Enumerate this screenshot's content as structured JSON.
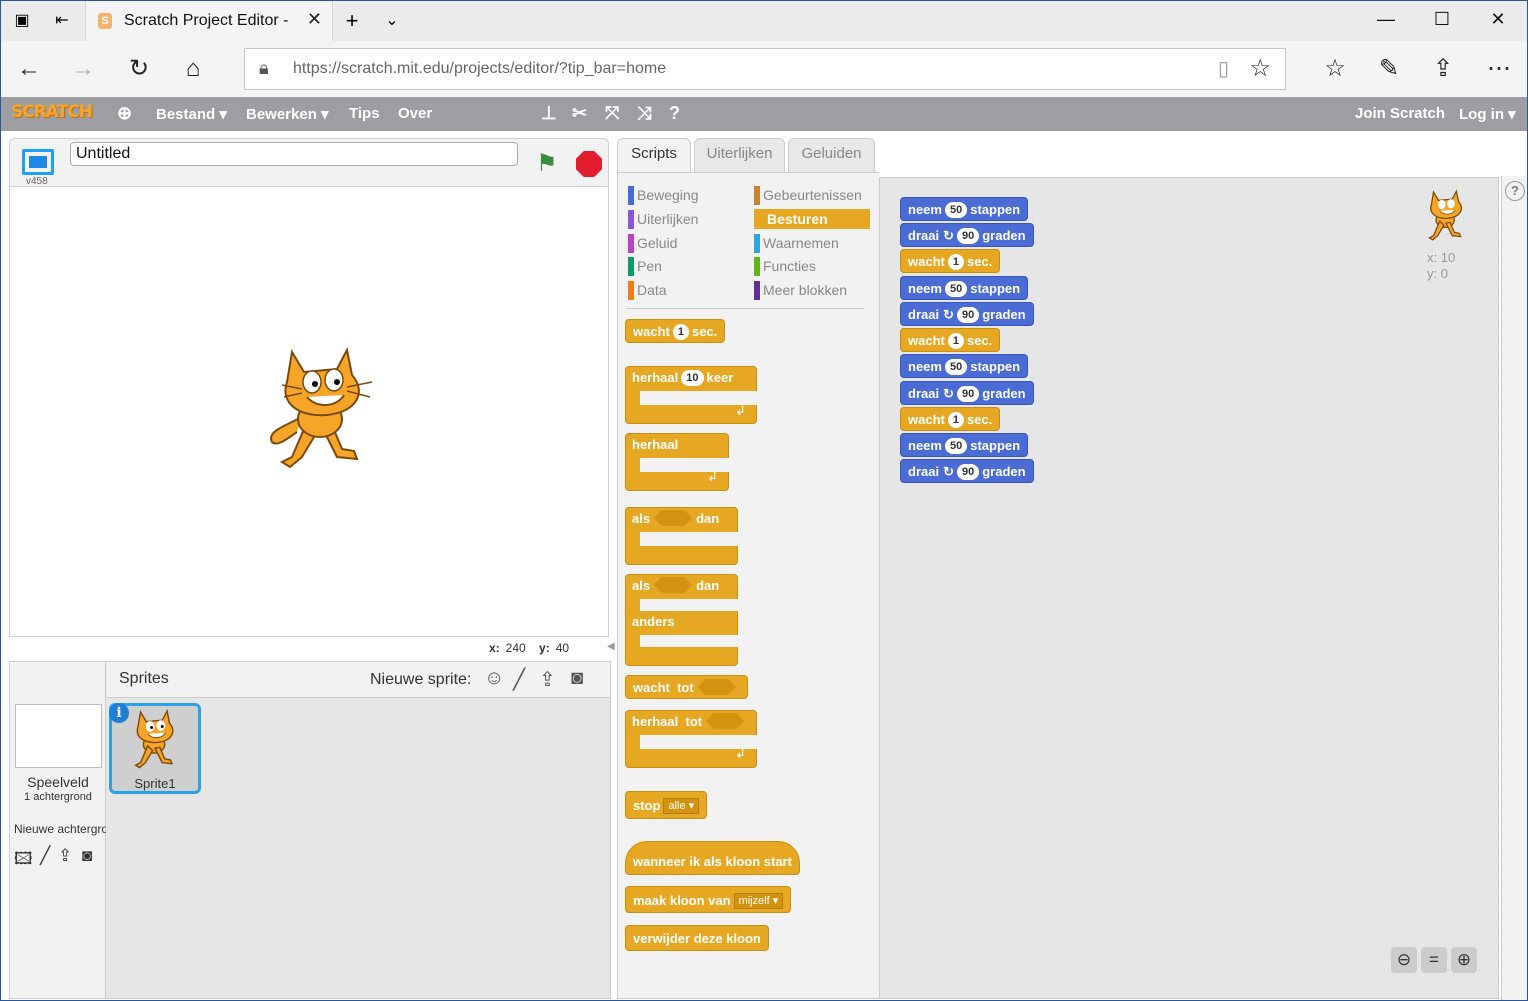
{
  "browser": {
    "tab_title": "Scratch Project Editor -",
    "url_host": "https://scratch.mit.edu",
    "url_path": "/projects/editor/?tip_bar=home"
  },
  "menu": {
    "logo": "SCRATCH",
    "file": "Bestand ▾",
    "edit": "Bewerken ▾",
    "tips": "Tips",
    "about": "Over",
    "join": "Join Scratch",
    "login": "Log in ▾"
  },
  "stage": {
    "title_value": "Untitled",
    "version": "v458",
    "x_label": "x:",
    "x_value": "240",
    "y_label": "y:",
    "y_value": "40"
  },
  "sprites": {
    "stage_name": "Speelveld",
    "stage_backdrops": "1 achtergrond",
    "new_backdrop": "Nieuwe achtergrond:",
    "header": "Sprites",
    "new_sprite": "Nieuwe sprite:",
    "sprite1": "Sprite1"
  },
  "tabs": [
    "Scripts",
    "Uiterlijken",
    "Geluiden"
  ],
  "categories": [
    {
      "label": "Beweging",
      "color": "#4a6cd4"
    },
    {
      "label": "Gebeurtenissen",
      "color": "#c88330"
    },
    {
      "label": "Uiterlijken",
      "color": "#8a55d7"
    },
    {
      "label": "Besturen",
      "color": "#e6a822"
    },
    {
      "label": "Geluid",
      "color": "#bb42c3"
    },
    {
      "label": "Waarnemen",
      "color": "#2ca5e2"
    },
    {
      "label": "Pen",
      "color": "#0e9a6c"
    },
    {
      "label": "Functies",
      "color": "#5cb712"
    },
    {
      "label": "Data",
      "color": "#ee7d16"
    },
    {
      "label": "Meer blokken",
      "color": "#632d99"
    }
  ],
  "palette": {
    "wait_1": "wacht",
    "wait_val": "1",
    "wait_2": "sec.",
    "repeat_1": "herhaal",
    "repeat_val": "10",
    "repeat_2": "keer",
    "forever": "herhaal",
    "if_1": "als",
    "if_2": "dan",
    "ifelse_1": "als",
    "ifelse_2": "dan",
    "ifelse_else": "anders",
    "waituntil_1": "wacht",
    "waituntil_2": "tot",
    "repeatuntil_1": "herhaal",
    "repeatuntil_2": "tot",
    "stop_1": "stop",
    "stop_val": "alle",
    "clone_hat": "wanneer  ik  als  kloon  start",
    "create_clone": "maak  kloon  van",
    "create_clone_val": "mijzelf",
    "delete_clone": "verwijder  deze  kloon"
  },
  "script": [
    {
      "type": "move",
      "a": "neem",
      "v": "50",
      "b": "stappen"
    },
    {
      "type": "turn",
      "a": "draai",
      "v": "90",
      "b": "graden"
    },
    {
      "type": "wait",
      "a": "wacht",
      "v": "1",
      "b": "sec."
    },
    {
      "type": "move",
      "a": "neem",
      "v": "50",
      "b": "stappen"
    },
    {
      "type": "turn",
      "a": "draai",
      "v": "90",
      "b": "graden"
    },
    {
      "type": "wait",
      "a": "wacht",
      "v": "1",
      "b": "sec."
    },
    {
      "type": "move",
      "a": "neem",
      "v": "50",
      "b": "stappen"
    },
    {
      "type": "turn",
      "a": "draai",
      "v": "90",
      "b": "graden"
    },
    {
      "type": "wait",
      "a": "wacht",
      "v": "1",
      "b": "sec."
    },
    {
      "type": "move",
      "a": "neem",
      "v": "50",
      "b": "stappen"
    },
    {
      "type": "turn",
      "a": "draai",
      "v": "90",
      "b": "graden"
    }
  ],
  "sprite_info": {
    "x": "x: 10",
    "y": "y: 0"
  },
  "icons": {
    "turn_arrow": "↻",
    "loop_arrow": "↲"
  }
}
